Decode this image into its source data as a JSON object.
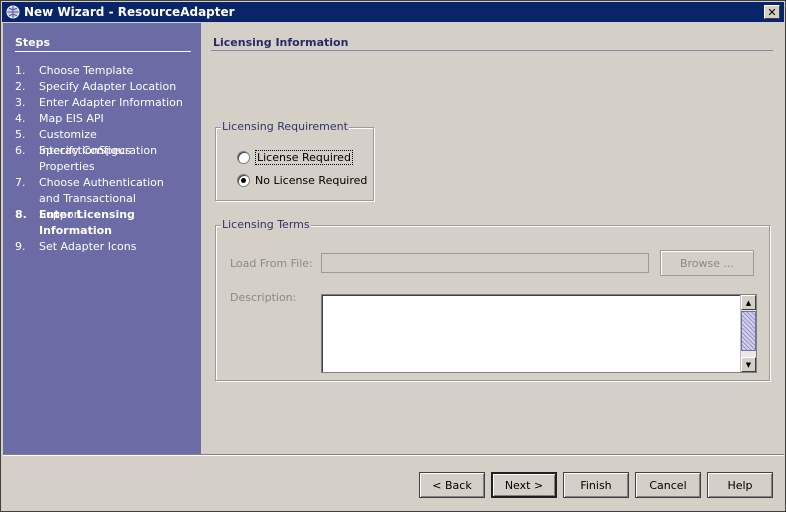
{
  "window": {
    "title": "New Wizard - ResourceAdapter",
    "close_glyph": "✕",
    "app_icon": "wizard-globe-icon"
  },
  "steps": {
    "header": "Steps",
    "items": [
      {
        "num": "1.",
        "label": "Choose Template"
      },
      {
        "num": "2.",
        "label": "Specify Adapter Location"
      },
      {
        "num": "3.",
        "label": "Enter Adapter Information"
      },
      {
        "num": "4.",
        "label": "Map EIS API"
      },
      {
        "num": "5.",
        "label": "Customize InteractionSpecs"
      },
      {
        "num": "6.",
        "label": "Specify Configuration Properties"
      },
      {
        "num": "7.",
        "label": "Choose Authentication and Transactional Support"
      },
      {
        "num": "8.",
        "label": "Enter Licensing Information"
      },
      {
        "num": "9.",
        "label": "Set Adapter Icons"
      }
    ],
    "current_index": 8
  },
  "content": {
    "title": "Licensing Information",
    "requirement": {
      "legend": "Licensing Requirement",
      "options": [
        {
          "label": "License Required",
          "checked": false
        },
        {
          "label": "No License Required",
          "checked": true
        }
      ]
    },
    "terms": {
      "legend": "Licensing Terms",
      "load_label": "Load From File:",
      "load_value": "",
      "browse_label": "Browse ...",
      "description_label": "Description:",
      "description_value": ""
    }
  },
  "buttons": {
    "back": "< Back",
    "next": "Next >",
    "finish": "Finish",
    "cancel": "Cancel",
    "help": "Help"
  }
}
